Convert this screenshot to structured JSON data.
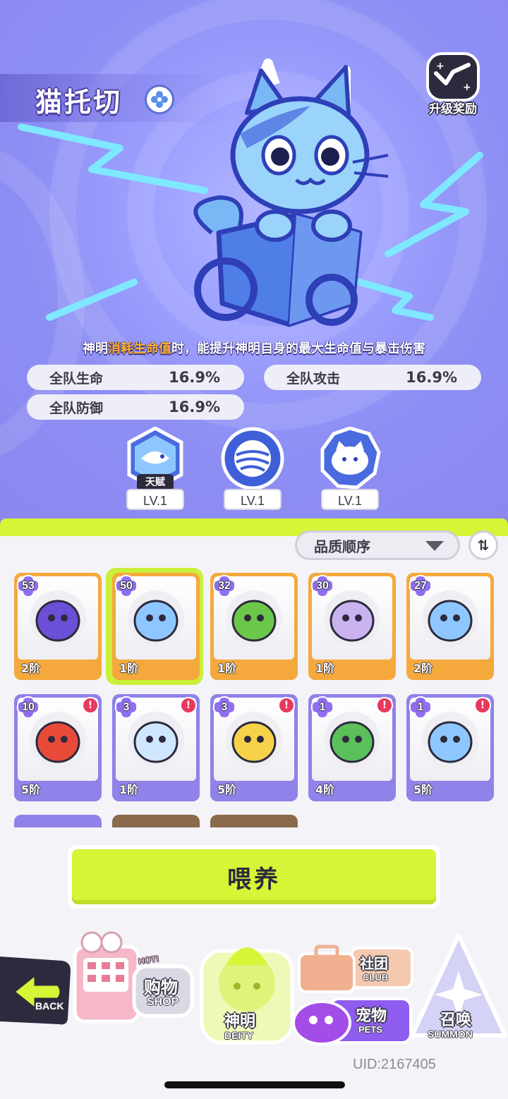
{
  "pet": {
    "name": "猫托切",
    "element_icon": "snowflake-icon",
    "description_prefix": "神明",
    "description_highlight": "消耗生命值",
    "description_suffix": "时，能提升神明自身的最大生命值与暴击伤害"
  },
  "upgrade_reward": {
    "label": "升级奖励",
    "icon": "boost-icon"
  },
  "stats": [
    {
      "label": "全队生命",
      "value": "16.9%"
    },
    {
      "label": "全队攻击",
      "value": "16.9%"
    },
    {
      "label": "全队防御",
      "value": "16.9%"
    }
  ],
  "skills": [
    {
      "icon": "fish-skill-icon",
      "tag": "天赋",
      "level": "LV.1"
    },
    {
      "icon": "yarn-ball-skill-icon",
      "level": "LV.1"
    },
    {
      "icon": "cat-skill-icon",
      "level": "LV.1"
    }
  ],
  "sort": {
    "selected": "品质顺序",
    "toggle_icon": "swap-order-icon",
    "toggle_glyph": "⇅"
  },
  "pets": [
    {
      "level": "53",
      "tier": "2阶",
      "rarity": "orange",
      "art": "grape-pet-icon",
      "selected": false,
      "alert": false
    },
    {
      "level": "50",
      "tier": "1阶",
      "rarity": "orange",
      "art": "box-cat-pet-icon",
      "selected": true,
      "alert": false
    },
    {
      "level": "32",
      "tier": "1阶",
      "rarity": "orange",
      "art": "leaf-frog-pet-icon",
      "selected": false,
      "alert": false
    },
    {
      "level": "30",
      "tier": "1阶",
      "rarity": "orange",
      "art": "pigeon-pet-icon",
      "selected": false,
      "alert": false
    },
    {
      "level": "27",
      "tier": "2阶",
      "rarity": "orange",
      "art": "axolotl-pet-icon",
      "selected": false,
      "alert": false
    },
    {
      "level": "10",
      "tier": "5阶",
      "rarity": "purple",
      "art": "red-fish-pet-icon",
      "selected": false,
      "alert": true
    },
    {
      "level": "3",
      "tier": "1阶",
      "rarity": "purple",
      "art": "cannon-cat-pet-icon",
      "selected": false,
      "alert": true
    },
    {
      "level": "3",
      "tier": "5阶",
      "rarity": "purple",
      "art": "bulb-jelly-pet-icon",
      "selected": false,
      "alert": true
    },
    {
      "level": "1",
      "tier": "4阶",
      "rarity": "purple",
      "art": "sprout-pet-icon",
      "selected": false,
      "alert": true
    },
    {
      "level": "1",
      "tier": "5阶",
      "rarity": "purple",
      "art": "water-bird-pet-icon",
      "selected": false,
      "alert": true
    }
  ],
  "alert_glyph": "!",
  "feed_button": {
    "label": "喂养"
  },
  "nav": {
    "back": {
      "en": "BACK"
    },
    "shop": {
      "cn": "购物",
      "en": "SHOP",
      "badge": "HOT!"
    },
    "deity": {
      "cn": "神明",
      "en": "DEITY"
    },
    "club": {
      "cn": "社团",
      "en": "CLUB"
    },
    "pets": {
      "cn": "宠物",
      "en": "PETS"
    },
    "summon": {
      "cn": "召唤",
      "en": "SUMMON"
    }
  },
  "uid": "UID:2167405",
  "colors": {
    "hero_bg": "#8d8ff4",
    "lime": "#d6f536",
    "orange_card": "#f5a93c",
    "purple_card": "#8f82e8",
    "alert": "#e8385e"
  }
}
